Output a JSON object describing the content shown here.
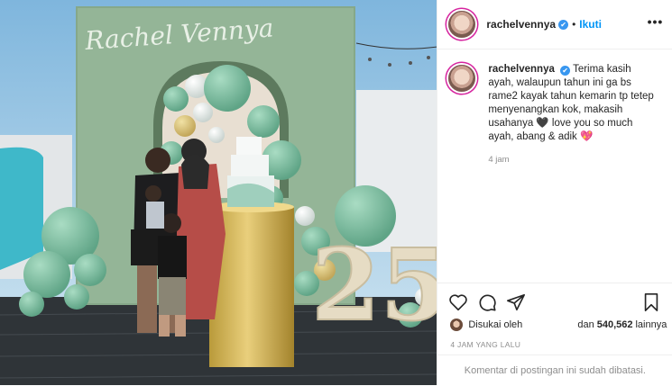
{
  "post": {
    "username": "rachelvennya",
    "verified_badge": "✔",
    "separator": "•",
    "follow_label": "Ikuti",
    "more_label": "•••",
    "caption_username": "rachelvennya",
    "caption_text": "Terima kasih ayah, walaupun tahun ini ga bs rame2 kayak tahun kemarin tp tetep menyenangkan kok, makasih usahanya 🖤 love you so much ayah, abang & adik 💖",
    "caption_time": "4 jam",
    "liked_by_label": "Disukai oleh",
    "likes_and": "dan",
    "likes_count": "540,562",
    "likes_suffix": "lainnya",
    "posted_ago": "4 JAM YANG LALU",
    "comments_closed": "Komentar di postingan ini sudah dibatasi."
  },
  "photo": {
    "backdrop_script": "Rachel Vennya",
    "number": "25",
    "icons": [
      "heart-icon",
      "comment-icon",
      "share-icon",
      "bookmark-icon",
      "more-icon",
      "verified-icon"
    ]
  },
  "colors": {
    "accent": "#0095f6",
    "verified": "#3897f0",
    "muted": "#8e8e8e",
    "balloon_green": "#7fc4a6",
    "backdrop_green": "#94b597"
  }
}
